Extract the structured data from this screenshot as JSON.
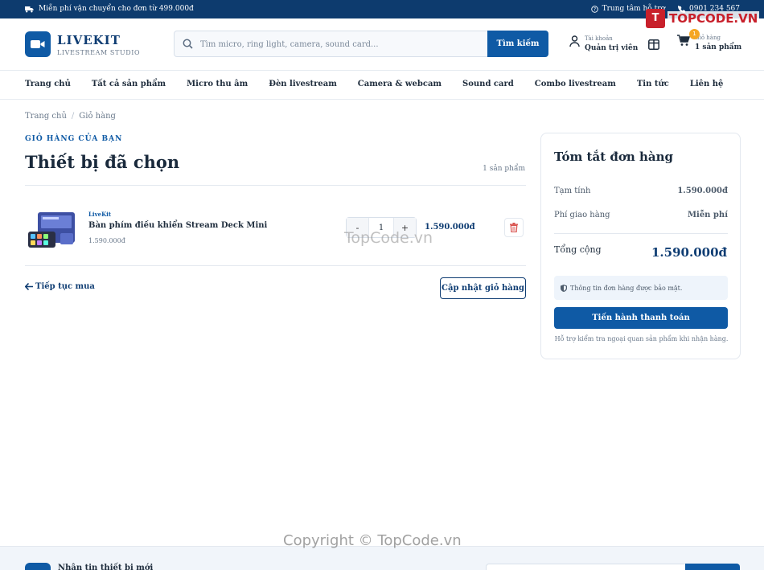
{
  "topbar": {
    "shipping_text": "Miễn phí vận chuyển cho đơn từ 499.000đ",
    "support_text": "Trung tâm hỗ trợ",
    "phone_text": "0901 234 567"
  },
  "header": {
    "brand_name": "LIVEKIT",
    "brand_tagline": "LIVESTREAM STUDIO",
    "search_placeholder": "Tìm micro, ring light, camera, sound card...",
    "search_button": "Tìm kiếm",
    "account_label": "Tài khoản",
    "account_name": "Quản trị viên",
    "cart_label": "Giỏ hàng",
    "cart_count_text": "1 sản phẩm",
    "cart_badge": "1"
  },
  "nav": {
    "items": [
      "Trang chủ",
      "Tất cả sản phẩm",
      "Micro thu âm",
      "Đèn livestream",
      "Camera & webcam",
      "Sound card",
      "Combo livestream",
      "Tin tức",
      "Liên hệ"
    ]
  },
  "breadcrumb": {
    "home": "Trang chủ",
    "separator": "/",
    "current": "Giỏ hàng"
  },
  "cart": {
    "eyebrow": "GIỎ HÀNG CỦA BẠN",
    "title": "Thiết bị đã chọn",
    "count": "1 sản phẩm",
    "items": [
      {
        "brand": "LiveKit",
        "name": "Bàn phím điều khiển Stream Deck Mini",
        "unit_price": "1.590.000đ",
        "quantity": "1",
        "line_total": "1.590.000đ"
      }
    ],
    "qty_minus": "-",
    "qty_plus": "+",
    "continue_label": "Tiếp tục mua",
    "update_label": "Cập nhật giỏ hàng"
  },
  "summary": {
    "title": "Tóm tắt đơn hàng",
    "subtotal_label": "Tạm tính",
    "subtotal_value": "1.590.000đ",
    "shipping_label": "Phí giao hàng",
    "shipping_value": "Miễn phí",
    "total_label": "Tổng cộng",
    "total_value": "1.590.000đ",
    "secure_note": "Thông tin đơn hàng được bảo mật.",
    "checkout_label": "Tiến hành thanh toán",
    "support_note": "Hỗ trợ kiểm tra ngoại quan sản phẩm khi nhận hàng."
  },
  "newsletter": {
    "title": "Nhận tin thiết bị mới"
  },
  "watermark": {
    "brand": "TOPCODE.VN",
    "center": "TopCode.vn",
    "copyright": "Copyright © TopCode.vn"
  },
  "colors": {
    "primary": "#0f5aa5",
    "topbar": "#0d3b6e",
    "badge": "#f5a623",
    "danger": "#d9534f"
  }
}
